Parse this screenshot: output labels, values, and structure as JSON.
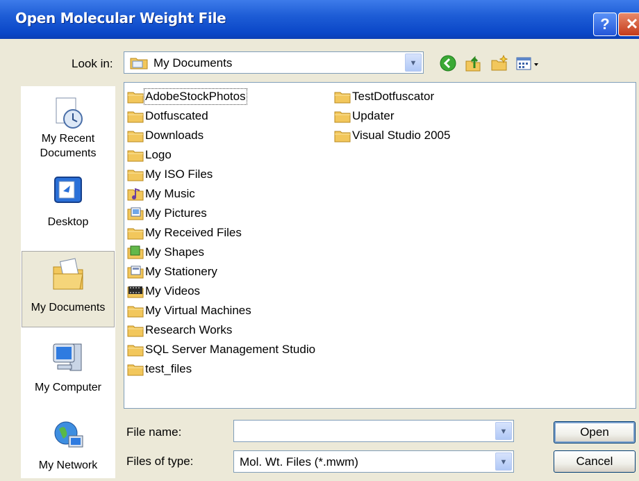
{
  "window": {
    "title": "Open Molecular Weight File",
    "help_glyph": "?",
    "close_glyph": "✕"
  },
  "lookin": {
    "label": "Look in:",
    "value": "My Documents"
  },
  "places": [
    {
      "label": "My Recent Documents",
      "icon": "recent-documents-icon"
    },
    {
      "label": "Desktop",
      "icon": "desktop-icon"
    },
    {
      "label": "My Documents",
      "icon": "my-documents-icon",
      "selected": true
    },
    {
      "label": "My Computer",
      "icon": "my-computer-icon"
    },
    {
      "label": "My Network",
      "icon": "my-network-icon"
    }
  ],
  "files": {
    "column1": [
      {
        "name": "AdobeStockPhotos",
        "icon": "folder-icon"
      },
      {
        "name": "Dotfuscated",
        "icon": "folder-icon"
      },
      {
        "name": "Downloads",
        "icon": "folder-icon"
      },
      {
        "name": "Logo",
        "icon": "folder-icon"
      },
      {
        "name": "My ISO Files",
        "icon": "folder-icon"
      },
      {
        "name": "My Music",
        "icon": "music-folder-icon"
      },
      {
        "name": "My Pictures",
        "icon": "pictures-folder-icon"
      },
      {
        "name": "My Received Files",
        "icon": "folder-icon"
      },
      {
        "name": "My Shapes",
        "icon": "shapes-folder-icon"
      },
      {
        "name": "My Stationery",
        "icon": "stationery-folder-icon"
      },
      {
        "name": "My Videos",
        "icon": "videos-folder-icon"
      },
      {
        "name": "My Virtual Machines",
        "icon": "folder-icon"
      },
      {
        "name": "Research Works",
        "icon": "folder-icon"
      },
      {
        "name": "SQL Server Management Studio",
        "icon": "folder-icon"
      },
      {
        "name": "test_files",
        "icon": "folder-icon"
      }
    ],
    "column2": [
      {
        "name": "TestDotfuscator",
        "icon": "folder-icon"
      },
      {
        "name": "Updater",
        "icon": "folder-icon"
      },
      {
        "name": "Visual Studio 2005",
        "icon": "folder-icon"
      }
    ]
  },
  "filename": {
    "label": "File name:",
    "value": ""
  },
  "filetype": {
    "label": "Files of type:",
    "value": "Mol. Wt. Files (*.mwm)"
  },
  "buttons": {
    "open": "Open",
    "cancel": "Cancel"
  },
  "colors": {
    "titlebar": "#0A47C8",
    "folder": "#F2C75C",
    "face": "#ECE9D8"
  }
}
